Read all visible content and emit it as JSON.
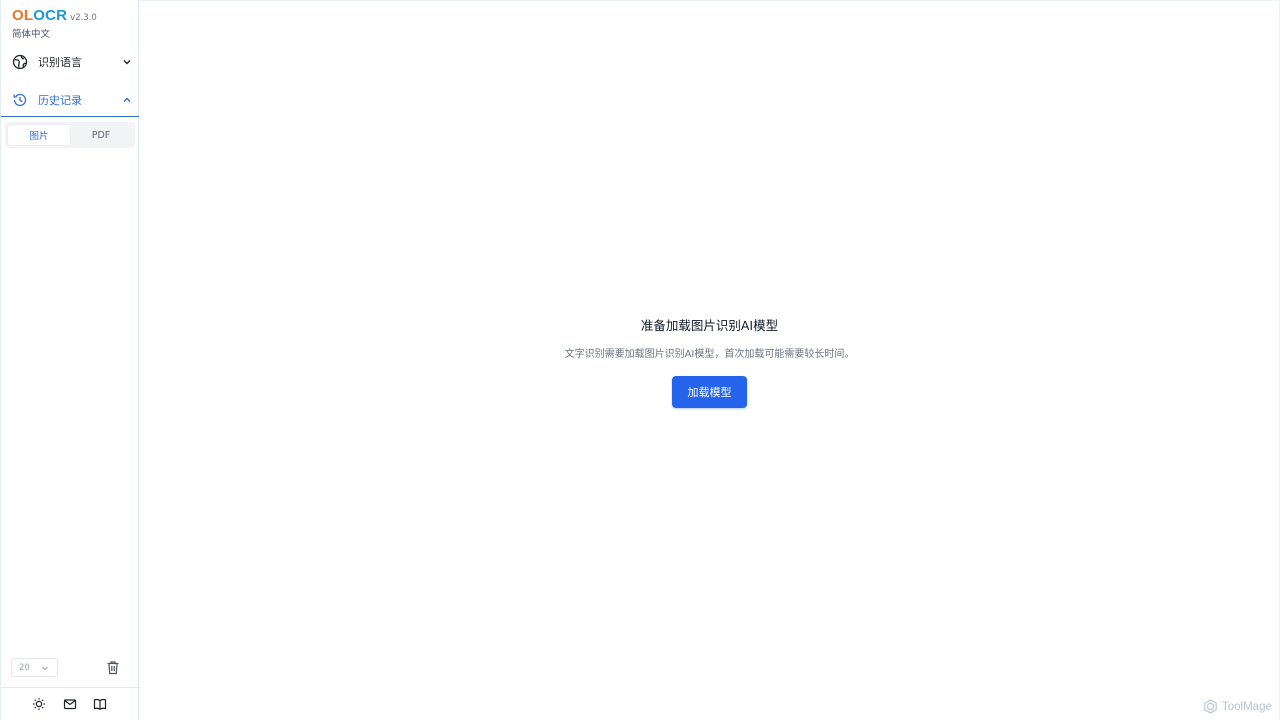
{
  "app": {
    "logo_part1": "OL",
    "logo_part2": "OCR",
    "version": "v2.3.0",
    "ui_language": "简体中文"
  },
  "sidebar": {
    "language_menu_label": "识别语言",
    "history_menu_label": "历史记录",
    "tabs": [
      {
        "label": "图片",
        "active": true
      },
      {
        "label": "PDF",
        "active": false
      }
    ],
    "page_size": "20"
  },
  "main": {
    "title": "准备加载图片识别AI模型",
    "subtitle": "文字识别需要加载图片识别AI模型，首次加载可能需要较长时间。",
    "load_button_label": "加载模型"
  },
  "watermark": "ToolMage",
  "colors": {
    "accent": "#2563eb",
    "logo_ol": "#e8772e",
    "logo_ocr": "#1a9ad6",
    "active_menu": "#2f6fd6"
  },
  "icons": {
    "language": "globe-icon",
    "history": "history-icon",
    "theme": "sun-icon",
    "mail": "mail-icon",
    "docs": "book-icon",
    "delete": "trash-icon"
  }
}
